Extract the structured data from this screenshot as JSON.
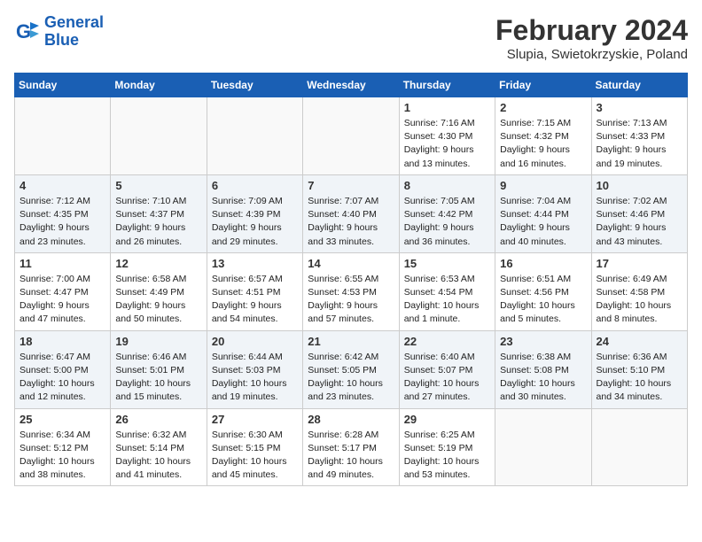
{
  "header": {
    "logo_line1": "General",
    "logo_line2": "Blue",
    "month": "February 2024",
    "location": "Slupia, Swietokrzyskie, Poland"
  },
  "weekdays": [
    "Sunday",
    "Monday",
    "Tuesday",
    "Wednesday",
    "Thursday",
    "Friday",
    "Saturday"
  ],
  "weeks": [
    [
      {
        "day": "",
        "info": ""
      },
      {
        "day": "",
        "info": ""
      },
      {
        "day": "",
        "info": ""
      },
      {
        "day": "",
        "info": ""
      },
      {
        "day": "1",
        "info": "Sunrise: 7:16 AM\nSunset: 4:30 PM\nDaylight: 9 hours\nand 13 minutes."
      },
      {
        "day": "2",
        "info": "Sunrise: 7:15 AM\nSunset: 4:32 PM\nDaylight: 9 hours\nand 16 minutes."
      },
      {
        "day": "3",
        "info": "Sunrise: 7:13 AM\nSunset: 4:33 PM\nDaylight: 9 hours\nand 19 minutes."
      }
    ],
    [
      {
        "day": "4",
        "info": "Sunrise: 7:12 AM\nSunset: 4:35 PM\nDaylight: 9 hours\nand 23 minutes."
      },
      {
        "day": "5",
        "info": "Sunrise: 7:10 AM\nSunset: 4:37 PM\nDaylight: 9 hours\nand 26 minutes."
      },
      {
        "day": "6",
        "info": "Sunrise: 7:09 AM\nSunset: 4:39 PM\nDaylight: 9 hours\nand 29 minutes."
      },
      {
        "day": "7",
        "info": "Sunrise: 7:07 AM\nSunset: 4:40 PM\nDaylight: 9 hours\nand 33 minutes."
      },
      {
        "day": "8",
        "info": "Sunrise: 7:05 AM\nSunset: 4:42 PM\nDaylight: 9 hours\nand 36 minutes."
      },
      {
        "day": "9",
        "info": "Sunrise: 7:04 AM\nSunset: 4:44 PM\nDaylight: 9 hours\nand 40 minutes."
      },
      {
        "day": "10",
        "info": "Sunrise: 7:02 AM\nSunset: 4:46 PM\nDaylight: 9 hours\nand 43 minutes."
      }
    ],
    [
      {
        "day": "11",
        "info": "Sunrise: 7:00 AM\nSunset: 4:47 PM\nDaylight: 9 hours\nand 47 minutes."
      },
      {
        "day": "12",
        "info": "Sunrise: 6:58 AM\nSunset: 4:49 PM\nDaylight: 9 hours\nand 50 minutes."
      },
      {
        "day": "13",
        "info": "Sunrise: 6:57 AM\nSunset: 4:51 PM\nDaylight: 9 hours\nand 54 minutes."
      },
      {
        "day": "14",
        "info": "Sunrise: 6:55 AM\nSunset: 4:53 PM\nDaylight: 9 hours\nand 57 minutes."
      },
      {
        "day": "15",
        "info": "Sunrise: 6:53 AM\nSunset: 4:54 PM\nDaylight: 10 hours\nand 1 minute."
      },
      {
        "day": "16",
        "info": "Sunrise: 6:51 AM\nSunset: 4:56 PM\nDaylight: 10 hours\nand 5 minutes."
      },
      {
        "day": "17",
        "info": "Sunrise: 6:49 AM\nSunset: 4:58 PM\nDaylight: 10 hours\nand 8 minutes."
      }
    ],
    [
      {
        "day": "18",
        "info": "Sunrise: 6:47 AM\nSunset: 5:00 PM\nDaylight: 10 hours\nand 12 minutes."
      },
      {
        "day": "19",
        "info": "Sunrise: 6:46 AM\nSunset: 5:01 PM\nDaylight: 10 hours\nand 15 minutes."
      },
      {
        "day": "20",
        "info": "Sunrise: 6:44 AM\nSunset: 5:03 PM\nDaylight: 10 hours\nand 19 minutes."
      },
      {
        "day": "21",
        "info": "Sunrise: 6:42 AM\nSunset: 5:05 PM\nDaylight: 10 hours\nand 23 minutes."
      },
      {
        "day": "22",
        "info": "Sunrise: 6:40 AM\nSunset: 5:07 PM\nDaylight: 10 hours\nand 27 minutes."
      },
      {
        "day": "23",
        "info": "Sunrise: 6:38 AM\nSunset: 5:08 PM\nDaylight: 10 hours\nand 30 minutes."
      },
      {
        "day": "24",
        "info": "Sunrise: 6:36 AM\nSunset: 5:10 PM\nDaylight: 10 hours\nand 34 minutes."
      }
    ],
    [
      {
        "day": "25",
        "info": "Sunrise: 6:34 AM\nSunset: 5:12 PM\nDaylight: 10 hours\nand 38 minutes."
      },
      {
        "day": "26",
        "info": "Sunrise: 6:32 AM\nSunset: 5:14 PM\nDaylight: 10 hours\nand 41 minutes."
      },
      {
        "day": "27",
        "info": "Sunrise: 6:30 AM\nSunset: 5:15 PM\nDaylight: 10 hours\nand 45 minutes."
      },
      {
        "day": "28",
        "info": "Sunrise: 6:28 AM\nSunset: 5:17 PM\nDaylight: 10 hours\nand 49 minutes."
      },
      {
        "day": "29",
        "info": "Sunrise: 6:25 AM\nSunset: 5:19 PM\nDaylight: 10 hours\nand 53 minutes."
      },
      {
        "day": "",
        "info": ""
      },
      {
        "day": "",
        "info": ""
      }
    ]
  ]
}
